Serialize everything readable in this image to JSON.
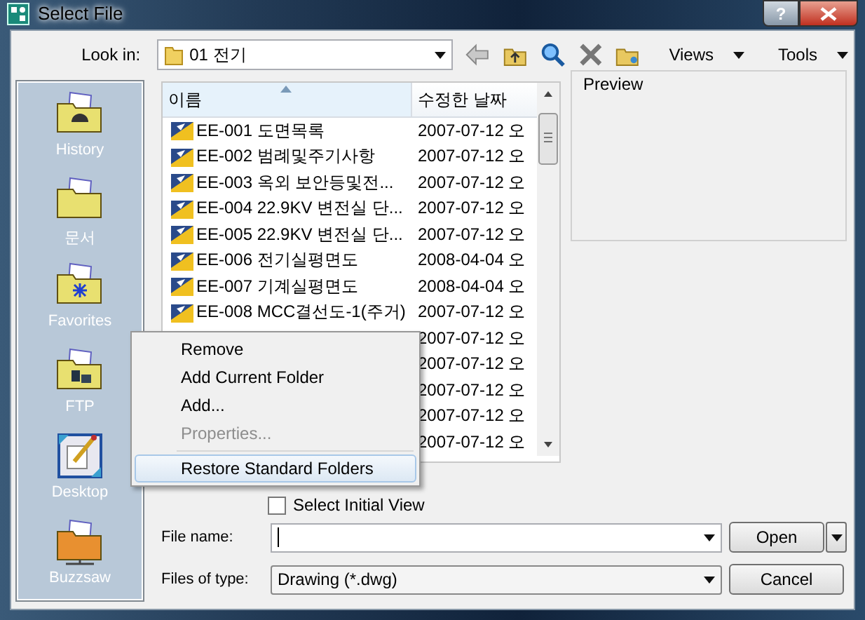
{
  "window": {
    "title": "Select File",
    "help": "?"
  },
  "toolbar": {
    "look_in_label": "Look in:",
    "look_in_value": "01 전기",
    "views": "Views",
    "tools": "Tools"
  },
  "sidebar": {
    "items": [
      {
        "label": "History",
        "kind": "history"
      },
      {
        "label": "문서",
        "kind": "documents"
      },
      {
        "label": "Favorites",
        "kind": "favorites"
      },
      {
        "label": "FTP",
        "kind": "ftp"
      },
      {
        "label": "Desktop",
        "kind": "desktop"
      },
      {
        "label": "Buzzsaw",
        "kind": "buzzsaw"
      }
    ]
  },
  "file_list": {
    "columns": [
      "이름",
      "수정한 날짜"
    ],
    "rows": [
      {
        "name": "EE-001 도면목록",
        "date": "2007-07-12 오"
      },
      {
        "name": "EE-002 범례및주기사항",
        "date": "2007-07-12 오"
      },
      {
        "name": "EE-003 옥외 보안등및전...",
        "date": "2007-07-12 오"
      },
      {
        "name": "EE-004 22.9KV 변전실 단...",
        "date": "2007-07-12 오"
      },
      {
        "name": "EE-005 22.9KV 변전실 단...",
        "date": "2007-07-12 오"
      },
      {
        "name": "EE-006 전기실평면도",
        "date": "2008-04-04 오"
      },
      {
        "name": "EE-007 기계실평면도",
        "date": "2008-04-04 오"
      },
      {
        "name": "EE-008 MCC결선도-1(주거)",
        "date": "2007-07-12 오"
      },
      {
        "date": "2007-07-12 오"
      },
      {
        "date": "2007-07-12 오"
      },
      {
        "date": "2007-07-12 오"
      },
      {
        "date": "2007-07-12 오"
      },
      {
        "date": "2007-07-12 오"
      }
    ]
  },
  "preview": {
    "label": "Preview"
  },
  "initial_view": {
    "label": "Select Initial View",
    "checked": false
  },
  "file_name": {
    "label": "File name:"
  },
  "files_of_type": {
    "label": "Files of type:",
    "value": "Drawing (*.dwg)"
  },
  "buttons": {
    "open": "Open",
    "cancel": "Cancel"
  },
  "context_menu": {
    "items": [
      {
        "kind": "item",
        "label": "Remove",
        "disabled": false,
        "selected": false
      },
      {
        "kind": "item",
        "label": "Add Current Folder",
        "disabled": false,
        "selected": false
      },
      {
        "kind": "item",
        "label": "Add...",
        "disabled": false,
        "selected": false
      },
      {
        "kind": "item",
        "label": "Properties...",
        "disabled": true,
        "selected": false
      },
      {
        "kind": "separator"
      },
      {
        "kind": "item",
        "label": "Restore Standard Folders",
        "disabled": false,
        "selected": true
      }
    ]
  }
}
